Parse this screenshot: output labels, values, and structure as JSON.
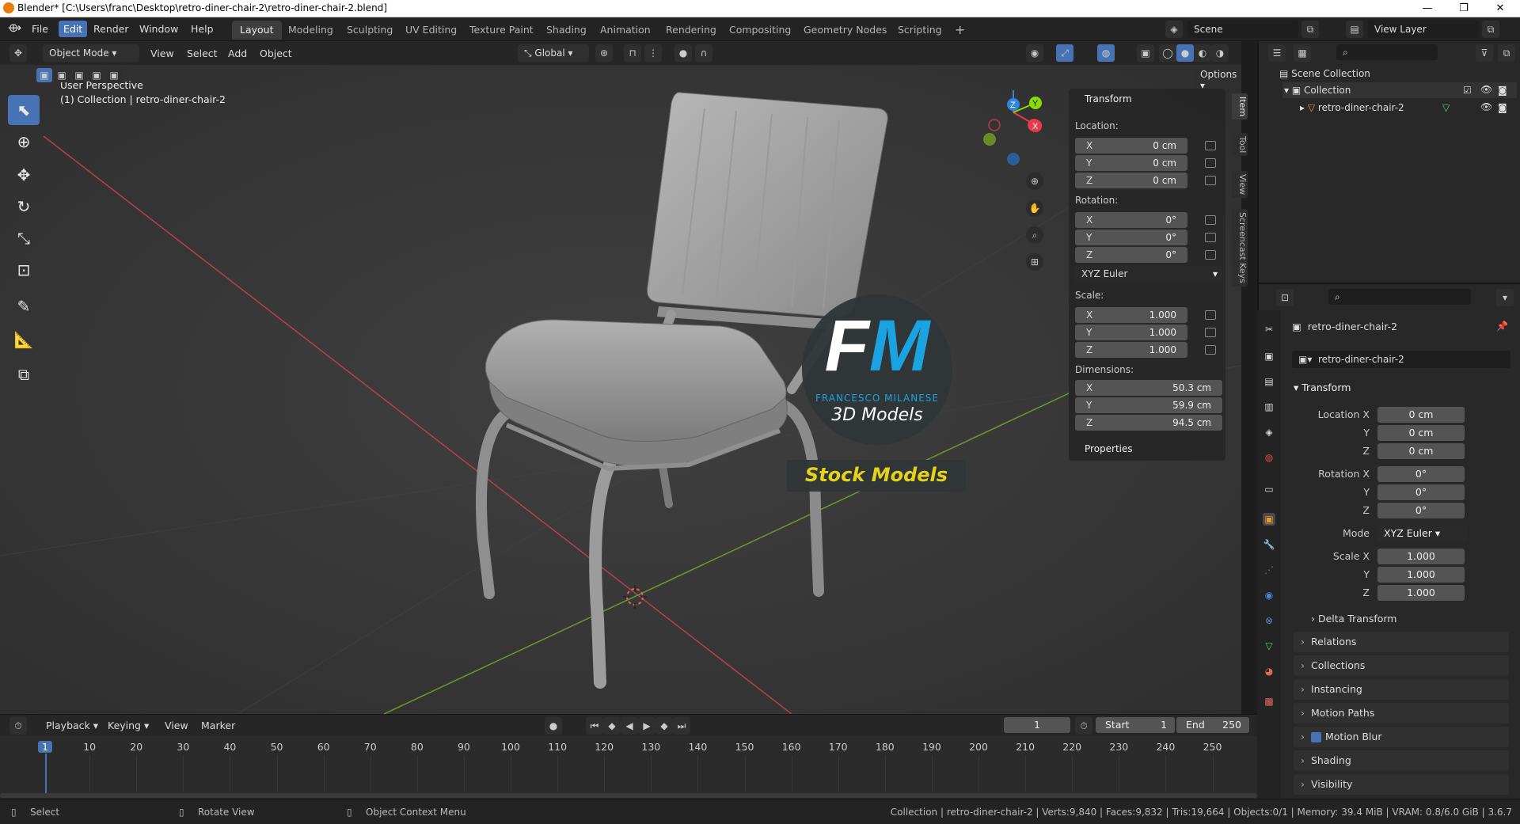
{
  "window": {
    "title": "Blender* [C:\\Users\\franc\\Desktop\\retro-diner-chair-2\\retro-diner-chair-2.blend]"
  },
  "menus": [
    "File",
    "Edit",
    "Render",
    "Window",
    "Help"
  ],
  "workspaces": [
    "Layout",
    "Modeling",
    "Sculpting",
    "UV Editing",
    "Texture Paint",
    "Shading",
    "Animation",
    "Rendering",
    "Compositing",
    "Geometry Nodes",
    "Scripting"
  ],
  "scene": {
    "label": "Scene",
    "view_layer": "View Layer"
  },
  "viewport_header": {
    "mode": "Object Mode",
    "menus": [
      "View",
      "Select",
      "Add",
      "Object"
    ],
    "orientation": "Global",
    "options": "Options"
  },
  "viewport": {
    "perspective": "User Perspective",
    "collection_line": "(1) Collection | retro-diner-chair-2"
  },
  "watermark": {
    "brand": "FRANCESCO MILANESE",
    "sub": "3D Models",
    "banner": "Stock Models",
    "fm_f": "F",
    "fm_m": "M"
  },
  "npanel": {
    "section": "Transform",
    "location_label": "Location:",
    "rotation_label": "Rotation:",
    "scale_label": "Scale:",
    "dimensions_label": "Dimensions:",
    "location": [
      {
        "axis": "X",
        "value": "0 cm"
      },
      {
        "axis": "Y",
        "value": "0 cm"
      },
      {
        "axis": "Z",
        "value": "0 cm"
      }
    ],
    "rotation": [
      {
        "axis": "X",
        "value": "0°"
      },
      {
        "axis": "Y",
        "value": "0°"
      },
      {
        "axis": "Z",
        "value": "0°"
      }
    ],
    "rotation_mode": "XYZ Euler",
    "scale": [
      {
        "axis": "X",
        "value": "1.000"
      },
      {
        "axis": "Y",
        "value": "1.000"
      },
      {
        "axis": "Z",
        "value": "1.000"
      }
    ],
    "dimensions": [
      {
        "axis": "X",
        "value": "50.3 cm"
      },
      {
        "axis": "Y",
        "value": "59.9 cm"
      },
      {
        "axis": "Z",
        "value": "94.5 cm"
      }
    ],
    "properties": "Properties",
    "tabs": [
      "Item",
      "Tool",
      "View",
      "Screencast Keys"
    ]
  },
  "outliner": {
    "scene_collection": "Scene Collection",
    "collection": "Collection",
    "object": "retro-diner-chair-2"
  },
  "properties": {
    "object_name": "retro-diner-chair-2",
    "data_name": "retro-diner-chair-2",
    "transform": "Transform",
    "location": {
      "labels": [
        "Location X",
        "Y",
        "Z"
      ],
      "values": [
        "0 cm",
        "0 cm",
        "0 cm"
      ]
    },
    "rotation": {
      "labels": [
        "Rotation X",
        "Y",
        "Z"
      ],
      "values": [
        "0°",
        "0°",
        "0°"
      ]
    },
    "mode_label": "Mode",
    "mode_value": "XYZ Euler",
    "scale": {
      "labels": [
        "Scale X",
        "Y",
        "Z"
      ],
      "values": [
        "1.000",
        "1.000",
        "1.000"
      ]
    },
    "sections": [
      "Delta Transform",
      "Relations",
      "Collections",
      "Instancing",
      "Motion Paths",
      "Motion Blur",
      "Shading",
      "Visibility"
    ]
  },
  "timeline": {
    "menus": [
      "Playback",
      "Keying",
      "View",
      "Marker"
    ],
    "current_frame": "1",
    "start_label": "Start",
    "start": "1",
    "end_label": "End",
    "end": "250",
    "ticks": [
      "1",
      "10",
      "20",
      "30",
      "40",
      "50",
      "60",
      "70",
      "80",
      "90",
      "100",
      "110",
      "120",
      "130",
      "140",
      "150",
      "160",
      "170",
      "180",
      "190",
      "200",
      "210",
      "220",
      "230",
      "240",
      "250"
    ]
  },
  "statusbar": {
    "select": "Select",
    "rotate": "Rotate View",
    "context": "Object Context Menu",
    "info": "Collection | retro-diner-chair-2 | Verts:9,840 | Faces:9,832 | Tris:19,664 | Objects:0/1 | Memory: 39.4 MiB | VRAM: 0.8/6.0 GiB | 3.6.7"
  },
  "colors": {
    "accent": "#4772b3",
    "x_axis": "#e83a4c",
    "y_axis": "#8bdc00",
    "z_axis": "#2e86de",
    "fm_blue": "#1aa3e0",
    "banner_yellow": "#e6d21a"
  }
}
